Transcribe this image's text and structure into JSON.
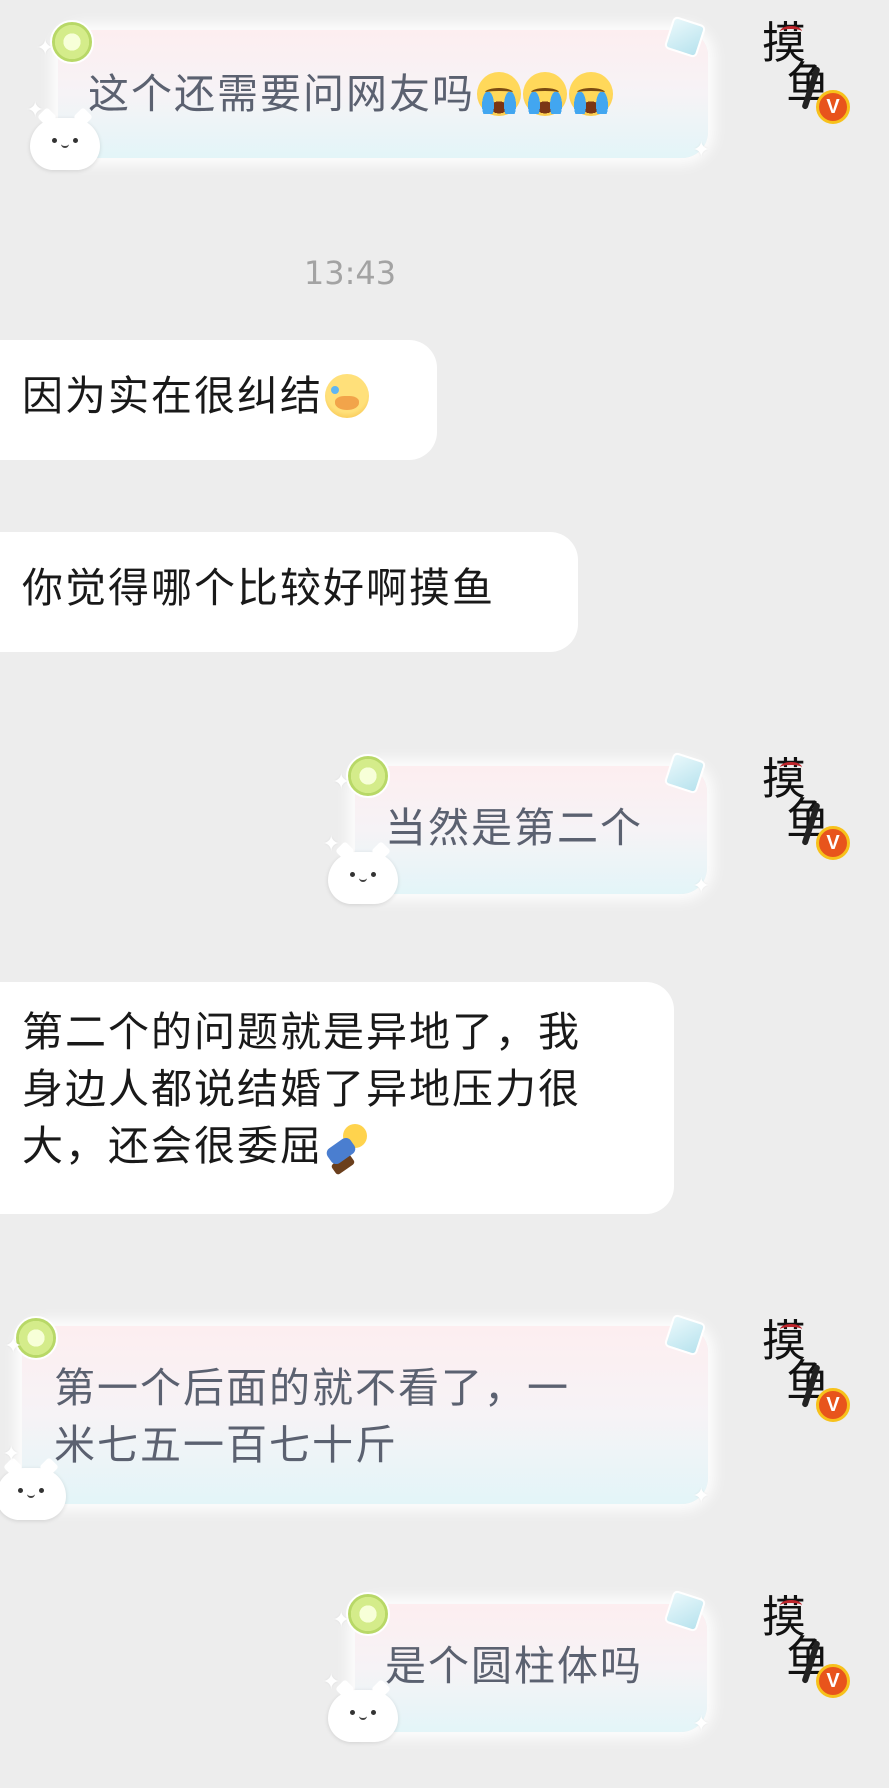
{
  "timestamp": "13:43",
  "messages": [
    {
      "side": "right",
      "text": "这个还需要问网友吗",
      "emoji": [
        "crying-face",
        "crying-face",
        "crying-face"
      ]
    },
    {
      "side": "left",
      "text": "因为实在很纠结",
      "emoji": [
        "face-holding-back-tears"
      ]
    },
    {
      "side": "left",
      "text": "你觉得哪个比较好啊摸鱼"
    },
    {
      "side": "right",
      "text": "当然是第二个"
    },
    {
      "side": "left",
      "lines": [
        "第二个的问题就是异地了，我",
        "身边人都说结婚了异地压力很",
        "大，还会很委屈"
      ],
      "emoji": [
        "falling-person"
      ]
    },
    {
      "side": "right",
      "lines": [
        "第一个后面的就不看了，一",
        "米七五一百七十斤"
      ]
    },
    {
      "side": "right",
      "text": "是个圆柱体吗"
    }
  ],
  "avatar": {
    "chars": [
      "摸",
      "鱼"
    ],
    "badge": "V"
  }
}
